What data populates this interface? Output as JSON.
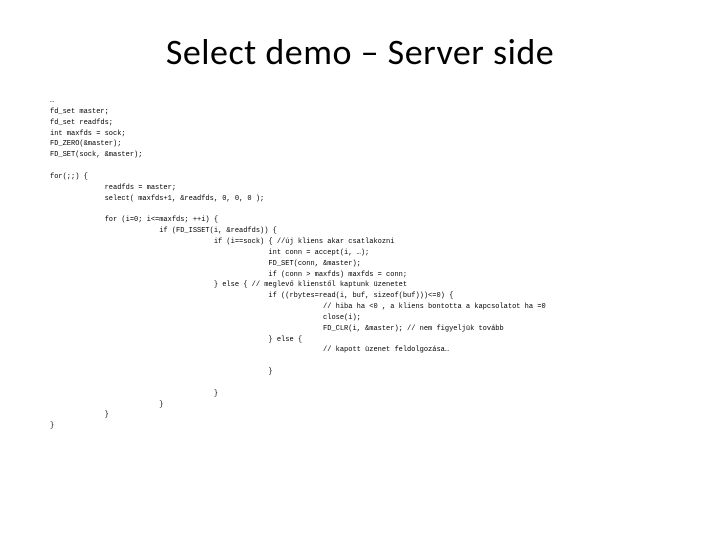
{
  "title": "Select demo – Server side",
  "code": "…\nfd_set master;\nfd_set readfds;\nint maxfds = sock;\nFD_ZERO(&master);\nFD_SET(sock, &master);\n\nfor(;;) {\n             readfds = master;\n             select( maxfds+1, &readfds, 0, 0, 0 );\n\n             for (i=0; i<=maxfds; ++i) {\n                          if (FD_ISSET(i, &readfds)) {\n                                       if (i==sock) { //új kliens akar csatlakozni\n                                                    int conn = accept(i, …);\n                                                    FD_SET(conn, &master);\n                                                    if (conn > maxfds) maxfds = conn;\n                                       } else { // meglevő klienstől kaptunk üzenetet\n                                                    if ((rbytes=read(i, buf, sizeof(buf)))<=0) {\n                                                                 // hiba ha <0 , a kliens bontotta a kapcsolatot ha =0\n                                                                 close(i);\n                                                                 FD_CLR(i, &master); // nem figyeljük tovább\n                                                    } else {\n                                                                 // kapott üzenet feldolgozása…\n\n                                                    }\n\n                                       }\n                          }\n             }\n}"
}
